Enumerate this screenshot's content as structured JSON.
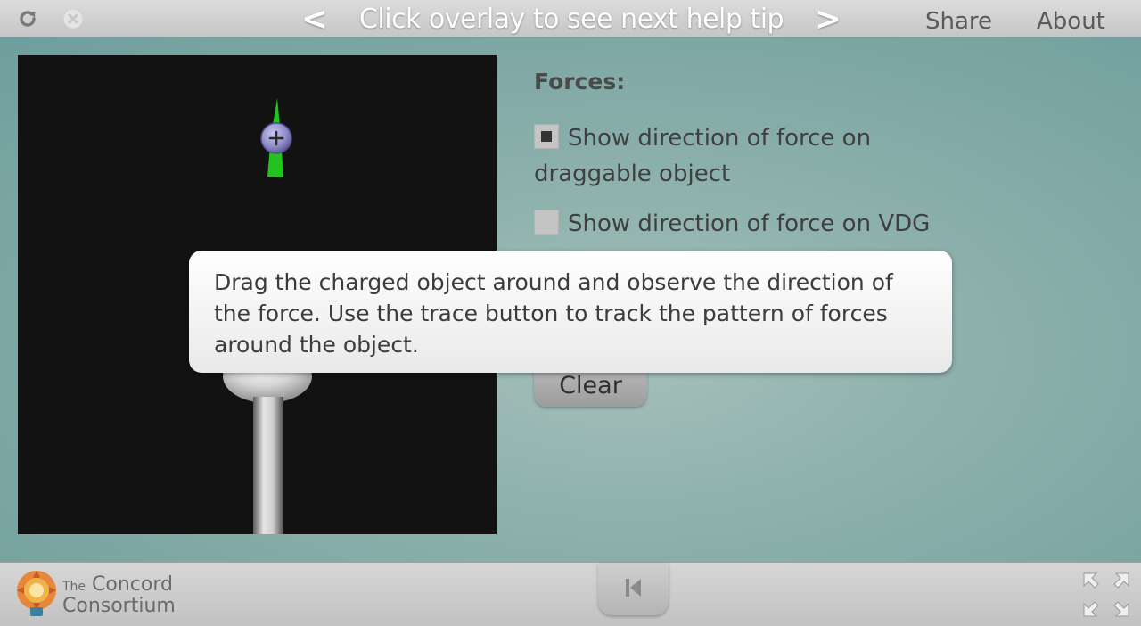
{
  "topbar": {
    "reload_icon": "reload-icon",
    "close_icon": "close-icon",
    "prev_arrow": "<",
    "next_arrow": ">",
    "help_text": "Click overlay to see next help tip",
    "share_label": "Share",
    "about_label": "About"
  },
  "controls": {
    "heading": "Forces:",
    "checkbox_1": {
      "label": "Show direction of force on draggable object",
      "checked": true
    },
    "checkbox_2": {
      "label": "Show direction of force on VDG",
      "checked": false
    },
    "clear_label": "Clear"
  },
  "tip": {
    "text": "Drag the charged object around and observe the direction of the force. Use the trace button to track the pattern of forces around the object."
  },
  "bottombar": {
    "logo_the": "The",
    "logo_line1": "Concord",
    "logo_line2": "Consortium",
    "reset_icon": "reset-to-start-icon",
    "fullscreen_icon": "fullscreen-icon"
  },
  "colors": {
    "background": "#6f9e9d",
    "force_arrow": "#22c21f",
    "charge": "#8a87c4"
  }
}
